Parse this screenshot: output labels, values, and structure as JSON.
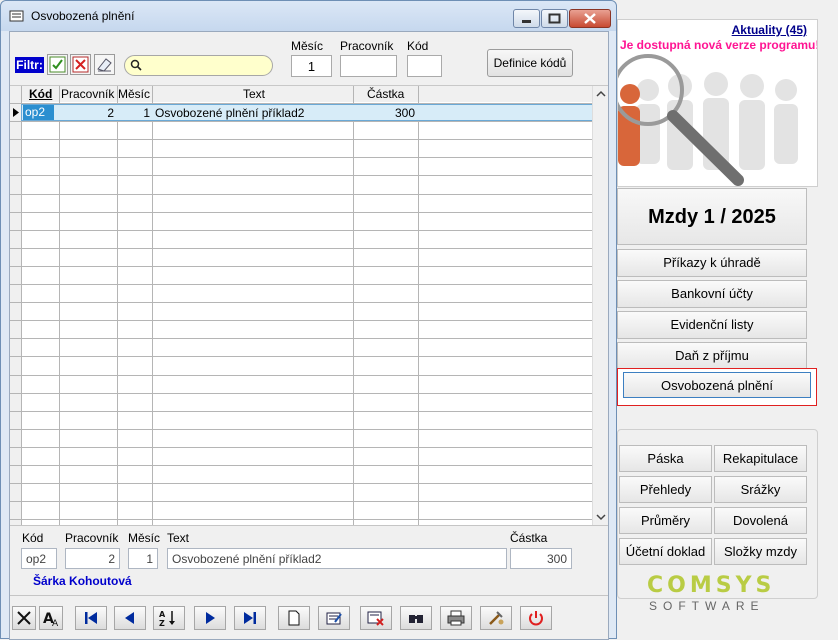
{
  "window": {
    "title": "Osvobozená plnění"
  },
  "filter": {
    "label": "Filtr:",
    "month_label": "Měsíc",
    "month_value": "1",
    "worker_label": "Pracovník",
    "worker_value": "",
    "code_label": "Kód",
    "code_value": "",
    "definitions_button": "Definice kódů"
  },
  "grid": {
    "columns": [
      "Kód",
      "Pracovník",
      "Měsíc",
      "Text",
      "Částka"
    ],
    "rows": [
      {
        "kod": "op2",
        "pracovnik": "2",
        "mesic": "1",
        "text": "Osvobozené plnění příklad2",
        "castka": "300"
      }
    ]
  },
  "detail": {
    "kod_label": "Kód",
    "kod_value": "op2",
    "worker_label": "Pracovník",
    "worker_value": "2",
    "month_label": "Měsíc",
    "month_value": "1",
    "text_label": "Text",
    "text_value": "Osvobozené plnění příklad2",
    "amount_label": "Částka",
    "amount_value": "300",
    "person": "Šárka Kohoutová"
  },
  "side": {
    "news_title": "Aktuality (45)",
    "news_message": "Je dostupná nová verze programu!",
    "period": "Mzdy  1 / 2025",
    "menu": [
      "Příkazy k úhradě",
      "Bankovní účty",
      "Evidenční listy",
      "Daň z příjmu",
      "Osvobozená plnění"
    ],
    "grid_buttons": [
      "Páska",
      "Rekapitulace",
      "Přehledy",
      "Srážky",
      "Průměry",
      "Dovolená",
      "Účetní doklad",
      "Složky mzdy"
    ],
    "logo_top": "COMSYS",
    "logo_bottom": "SOFTWARE"
  },
  "colors": {
    "accent": "#0000cc",
    "selection": "#2b8fd0",
    "news_message": "#ff1493",
    "logo": "#b9cc44"
  }
}
